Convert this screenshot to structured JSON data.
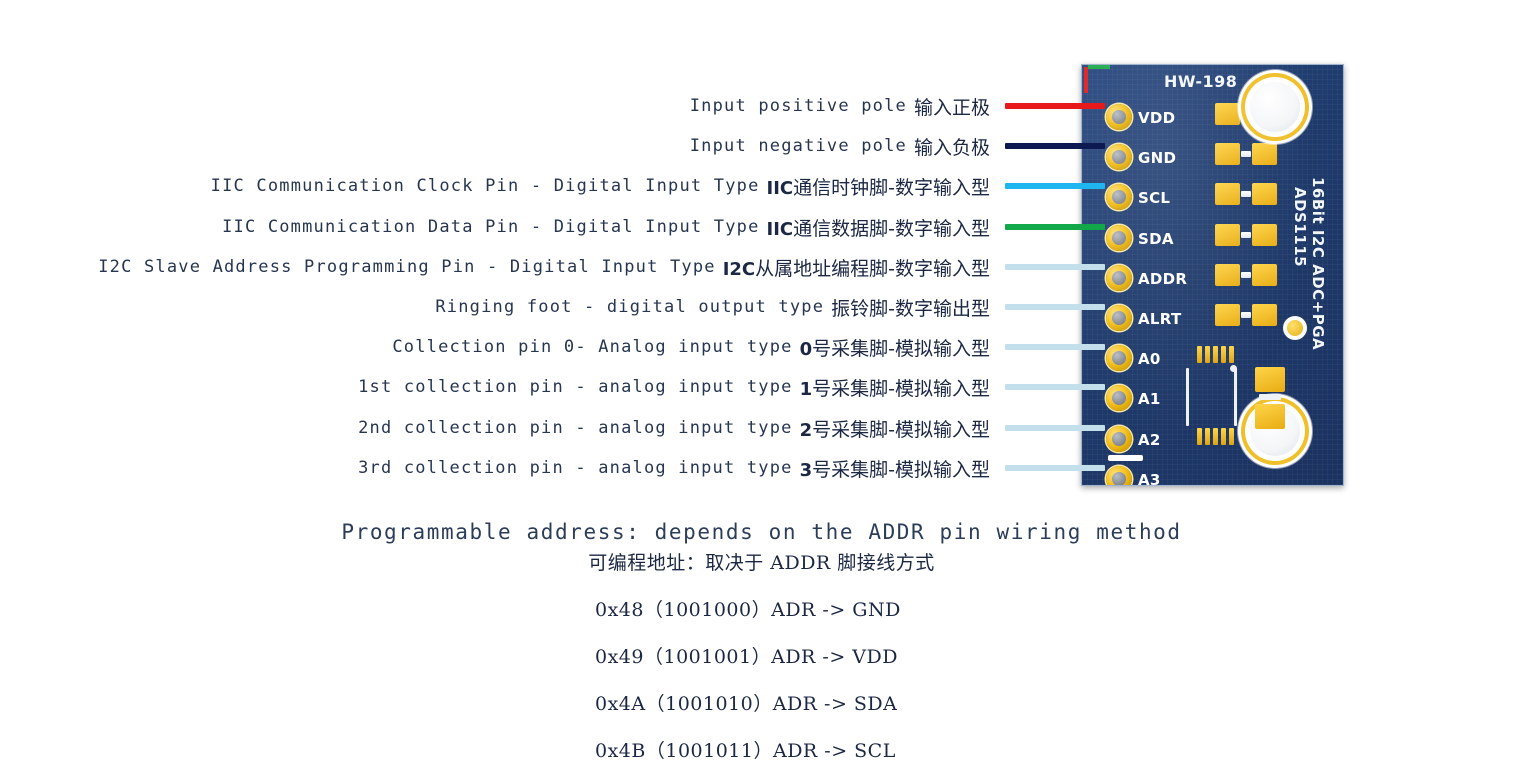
{
  "pin_rows": [
    {
      "en": "Input positive pole",
      "cn": "输入正极",
      "cn_lead": "",
      "pin": "VDD",
      "wire_color": "#e8191b"
    },
    {
      "en": "Input negative pole",
      "cn": "输入负极",
      "cn_lead": "",
      "pin": "GND",
      "wire_color": "#0d1a52"
    },
    {
      "en": "IIC Communication Clock Pin - Digital Input Type",
      "cn": "通信时钟脚-数字输入型",
      "cn_lead": "IIC",
      "pin": "SCL",
      "wire_color": "#1fb6ef"
    },
    {
      "en": "IIC Communication Data Pin - Digital Input Type",
      "cn": "通信数据脚-数字输入型",
      "cn_lead": "IIC",
      "pin": "SDA",
      "wire_color": "#12a84a"
    },
    {
      "en": "I2C Slave Address Programming Pin - Digital Input Type",
      "cn": "从属地址编程脚-数字输入型",
      "cn_lead": "I2C",
      "pin": "ADDR",
      "wire_color": "#c3dfeb"
    },
    {
      "en": "Ringing foot - digital output type",
      "cn": "振铃脚-数字输出型",
      "cn_lead": "",
      "pin": "ALRT",
      "wire_color": "#c3dfeb"
    },
    {
      "en": "Collection pin 0- Analog input type",
      "cn": "号采集脚-模拟输入型",
      "cn_lead": "0",
      "pin": "A0",
      "wire_color": "#c3dfeb"
    },
    {
      "en": "1st collection pin - analog input type",
      "cn": "号采集脚-模拟输入型",
      "cn_lead": "1",
      "pin": "A1",
      "wire_color": "#c3dfeb"
    },
    {
      "en": "2nd collection pin - analog input type",
      "cn": "号采集脚-模拟输入型",
      "cn_lead": "2",
      "pin": "A2",
      "wire_color": "#c3dfeb"
    },
    {
      "en": "3rd collection pin - analog input type",
      "cn": "号采集脚-模拟输入型",
      "cn_lead": "3",
      "pin": "A3",
      "wire_color": "#c3dfeb"
    }
  ],
  "board": {
    "silk_title": "HW-198",
    "vtext_line1": "16Bit I2C ADC+PGA",
    "vtext_line2": "ADS1115",
    "pcb_color": "#1e3a6b",
    "pad_color": "#f0c02a",
    "silk_color": "#ffffff"
  },
  "address_block": {
    "title_en": "Programmable address: depends on the ADDR pin wiring method",
    "title_cn": "可编程地址：取决于 ADDR 脚接线方式",
    "rows": [
      "0x48（1001000）ADR -> GND",
      "0x49（1001001）ADR -> VDD",
      "0x4A（1001010）ADR -> SDA",
      "0x4B（1001011）ADR -> SCL"
    ]
  }
}
